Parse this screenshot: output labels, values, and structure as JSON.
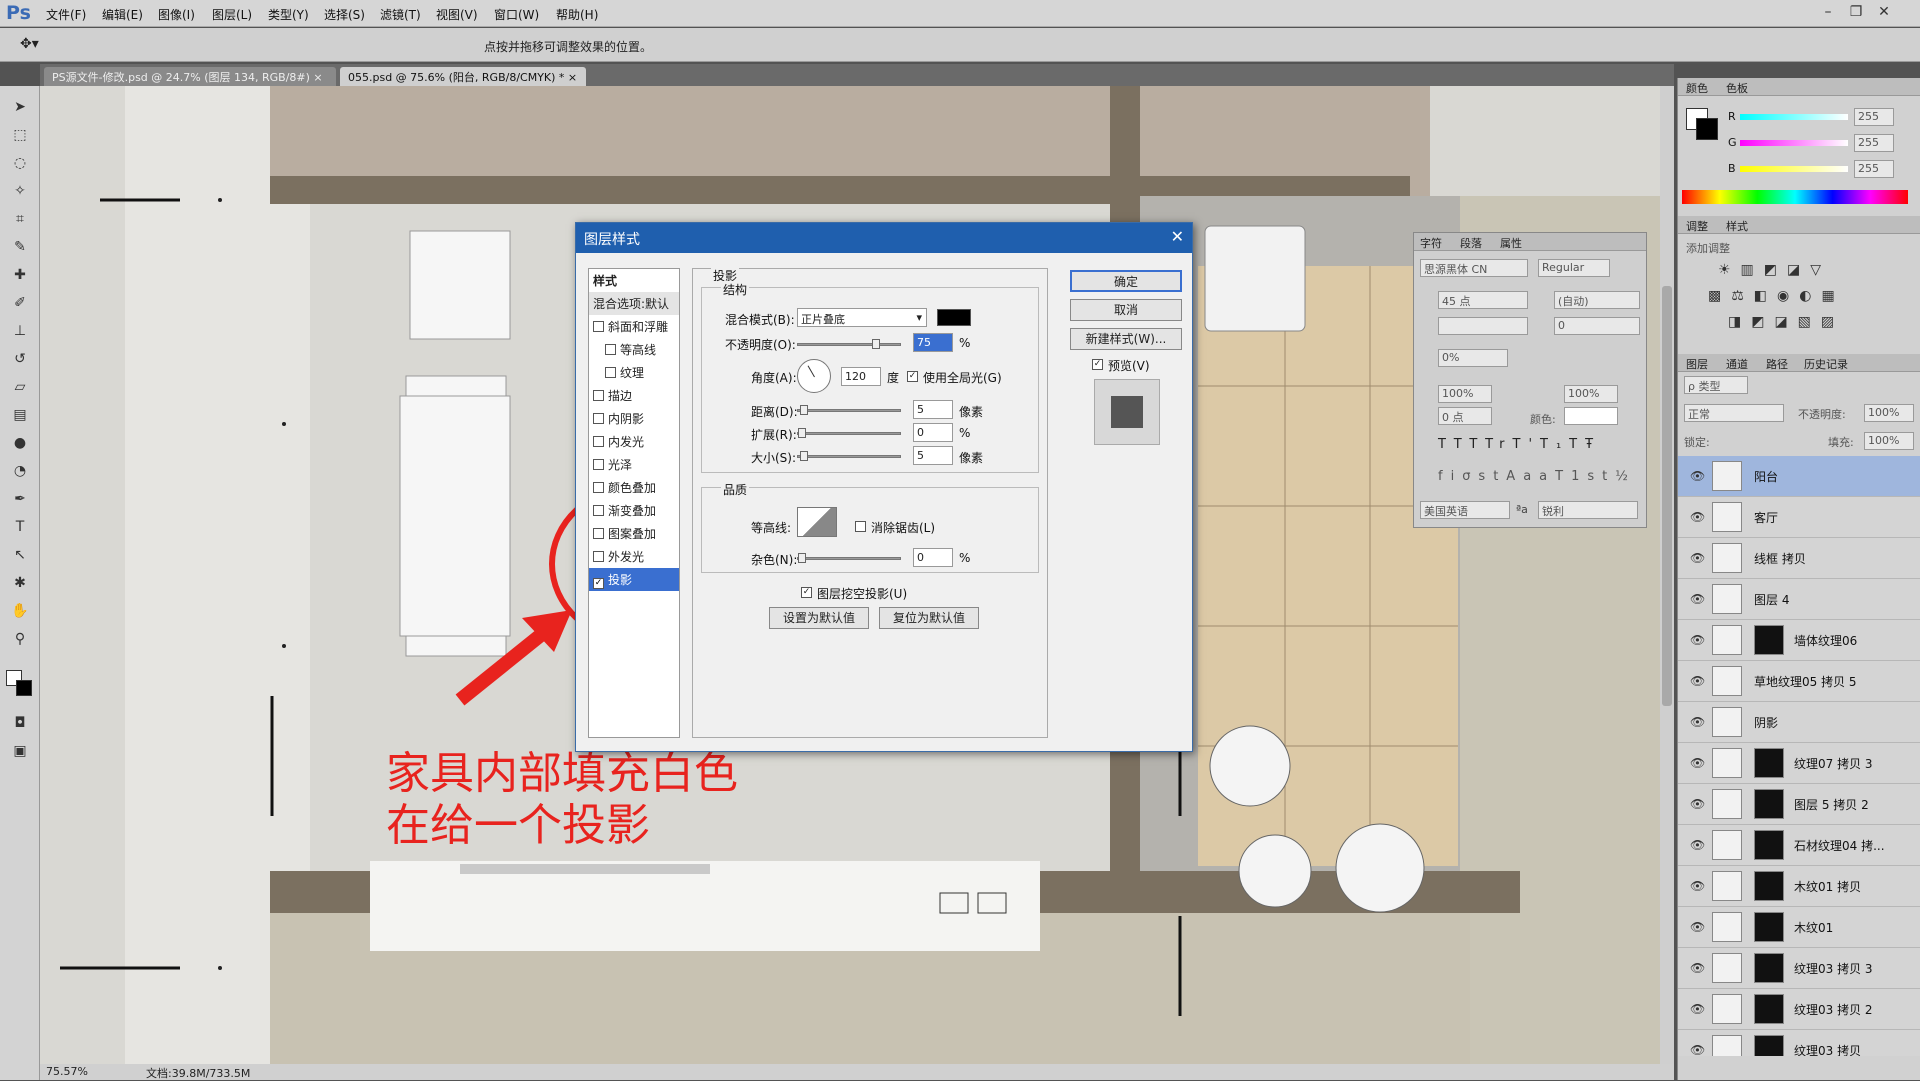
{
  "app": {
    "logo": "Ps"
  },
  "menu": [
    "文件(F)",
    "编辑(E)",
    "图像(I)",
    "图层(L)",
    "类型(Y)",
    "选择(S)",
    "滤镜(T)",
    "视图(V)",
    "窗口(W)",
    "帮助(H)"
  ],
  "options_bar": {
    "hint": "点按并拖移可调整效果的位置。"
  },
  "tabs": [
    {
      "label": "PS源文件-修改.psd @ 24.7% (图层 134, RGB/8#)"
    },
    {
      "label": "055.psd @ 75.6% (阳台, RGB/8/CMYK) *"
    }
  ],
  "status": {
    "zoom": "75.57%",
    "doc": "文档:39.8M/733.5M"
  },
  "dialog": {
    "title": "图层样式",
    "styles_header": "样式",
    "blend_options": "混合选项:默认",
    "style_items": [
      {
        "label": "斜面和浮雕",
        "checked": false
      },
      {
        "label": "等高线",
        "checked": false
      },
      {
        "label": "纹理",
        "checked": false
      },
      {
        "label": "描边",
        "checked": false
      },
      {
        "label": "内阴影",
        "checked": false
      },
      {
        "label": "内发光",
        "checked": false
      },
      {
        "label": "光泽",
        "checked": false
      },
      {
        "label": "颜色叠加",
        "checked": false
      },
      {
        "label": "渐变叠加",
        "checked": false
      },
      {
        "label": "图案叠加",
        "checked": false
      },
      {
        "label": "外发光",
        "checked": false
      },
      {
        "label": "投影",
        "checked": true
      }
    ],
    "section_title": "投影",
    "structure": "结构",
    "blend_mode_label": "混合模式(B):",
    "blend_mode_value": "正片叠底",
    "opacity_label": "不透明度(O):",
    "opacity_value": "75",
    "percent": "%",
    "angle_label": "角度(A):",
    "angle_value": "120",
    "angle_unit": "度",
    "global_light": "使用全局光(G)",
    "distance_label": "距离(D):",
    "distance_value": "5",
    "spread_label": "扩展(R):",
    "spread_value": "0",
    "size_label": "大小(S):",
    "size_value": "5",
    "pixels": "像素",
    "quality": "品质",
    "contour_label": "等高线:",
    "antialias": "消除锯齿(L)",
    "noise_label": "杂色(N):",
    "noise_value": "0",
    "knockout": "图层挖空投影(U)",
    "set_default": "设置为默认值",
    "reset_default": "复位为默认值",
    "ok": "确定",
    "cancel": "取消",
    "new_style": "新建样式(W)...",
    "preview": "预览(V)"
  },
  "annotation": {
    "line1": "家具内部填充白色",
    "line2": "在给一个投影"
  },
  "color_panel": {
    "tabs": [
      "颜色",
      "色板"
    ],
    "r": "255",
    "g": "255",
    "b": "255",
    "r_label": "R",
    "g_label": "G",
    "b_label": "B"
  },
  "adjust_panel": {
    "tabs": [
      "调整",
      "样式"
    ],
    "title": "添加调整"
  },
  "char_panel": {
    "tabs": [
      "字符",
      "段落",
      "属性"
    ],
    "font": "思源黑体 CN",
    "style": "Regular",
    "size": "45 点",
    "leading": "(自动)",
    "tracking": "0",
    "scale": "0%",
    "vscale": "100%",
    "hscale": "100%",
    "baseline": "0 点",
    "color_label": "颜色:",
    "lang": "美国英语",
    "aa": "锐利",
    "aa_icon": "ªa"
  },
  "layers_panel": {
    "tabs": [
      "图层",
      "通道",
      "路径",
      "历史记录"
    ],
    "filter": "ρ 类型",
    "mode": "正常",
    "opacity_label": "不透明度:",
    "opacity": "100%",
    "lock_label": "锁定:",
    "fill_label": "填充:",
    "fill": "100%",
    "layers": [
      {
        "name": "阳台",
        "mask": false,
        "selected": true
      },
      {
        "name": "客厅",
        "mask": false,
        "selected": false
      },
      {
        "name": "线框 拷贝",
        "mask": false,
        "selected": false
      },
      {
        "name": "图层 4",
        "mask": false,
        "selected": false
      },
      {
        "name": "墙体纹理06",
        "mask": true,
        "selected": false
      },
      {
        "name": "草地纹理05 拷贝 5",
        "mask": false,
        "selected": false
      },
      {
        "name": "阴影",
        "mask": false,
        "selected": false
      },
      {
        "name": "纹理07 拷贝 3",
        "mask": true,
        "selected": false
      },
      {
        "name": "图层 5 拷贝 2",
        "mask": true,
        "selected": false
      },
      {
        "name": "石材纹理04 拷...",
        "mask": true,
        "selected": false
      },
      {
        "name": "木纹01 拷贝",
        "mask": true,
        "selected": false
      },
      {
        "name": "木纹01",
        "mask": true,
        "selected": false
      },
      {
        "name": "纹理03 拷贝 3",
        "mask": true,
        "selected": false
      },
      {
        "name": "纹理03 拷贝 2",
        "mask": true,
        "selected": false
      },
      {
        "name": "纹理03 拷贝",
        "mask": true,
        "selected": false
      }
    ]
  }
}
